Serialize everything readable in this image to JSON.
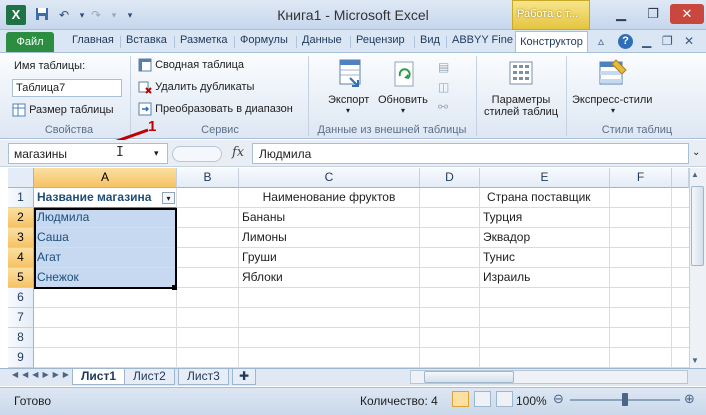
{
  "window": {
    "title": "Книга1 - Microsoft Excel",
    "context_tab": "Работа с т...",
    "logo_letter": "X"
  },
  "ribbon_tabs": {
    "file": "Файл",
    "tabs": [
      "Главная",
      "Вставка",
      "Разметка",
      "Формулы",
      "Данные",
      "Рецензир",
      "Вид",
      "ABBYY Fine"
    ],
    "active": "Конструктор"
  },
  "ribbon": {
    "properties": {
      "table_name_label": "Имя таблицы:",
      "table_name_value": "Таблица7",
      "resize_label": "Размер таблицы",
      "group_label": "Свойства"
    },
    "tools": {
      "pivot": "Сводная таблица",
      "remove_dup": "Удалить дубликаты",
      "convert": "Преобразовать в диапазон",
      "group_label": "Сервис"
    },
    "external": {
      "export": "Экспорт",
      "refresh": "Обновить",
      "group_label": "Данные из внешней таблицы"
    },
    "style_opts": {
      "label_line1": "Параметры",
      "label_line2": "стилей таблиц"
    },
    "styles": {
      "express": "Экспресс-стили",
      "group_label": "Стили таблиц"
    }
  },
  "formula_bar": {
    "name_box": "магазины",
    "fx": "fx",
    "value": "Людмила"
  },
  "annotation": {
    "number": "1"
  },
  "grid": {
    "columns": [
      "A",
      "B",
      "C",
      "D",
      "E",
      "F"
    ],
    "rows": [
      "1",
      "2",
      "3",
      "4",
      "5",
      "6",
      "7",
      "8",
      "9"
    ],
    "cells": {
      "A1": "Название магазина",
      "A2": "Людмила",
      "A3": "Саша",
      "A4": "Агат",
      "A5": "Снежок",
      "C1": "Наименование фруктов",
      "C2": "Бананы",
      "C3": "Лимоны",
      "C4": "Груши",
      "C5": "Яблоки",
      "E1": "Страна поставщик",
      "E2": "Турция",
      "E3": "Эквадор",
      "E4": "Тунис",
      "E5": "Израиль"
    }
  },
  "sheets": [
    "Лист1",
    "Лист2",
    "Лист3"
  ],
  "status": {
    "ready": "Готово",
    "count": "Количество: 4",
    "zoom": "100%",
    "zoom_level_percent": 100
  },
  "colors": {
    "accent": "#1f7244",
    "table_fill": "#c6d9f1",
    "annotation": "#c00000"
  }
}
